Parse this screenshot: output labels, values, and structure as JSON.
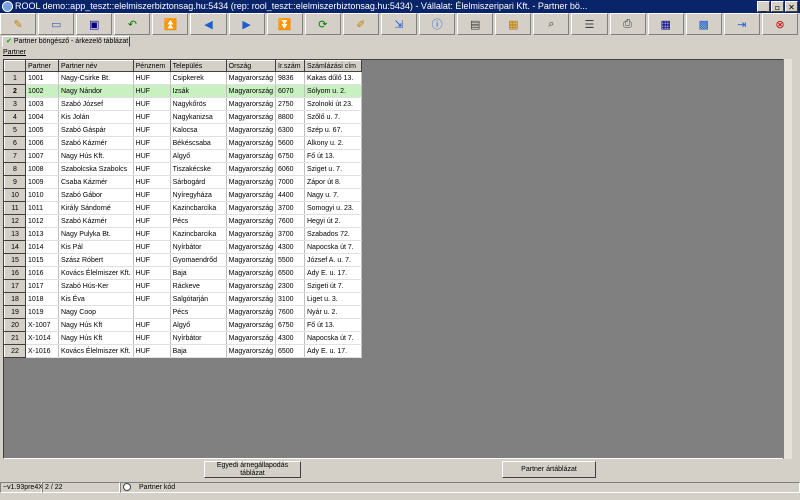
{
  "window": {
    "title": "ROOL demo::app_teszt::elelmiszerbiztonsag.hu:5434 (rep: rool_teszt::elelmiszerbiztonsag.hu:5434) - Vállalat: Élelmiszeripari Kft. - Partner bö...",
    "minimize": "_",
    "restore": "▫",
    "close": "✕"
  },
  "toolbar": [
    {
      "name": "edit-icon",
      "glyph": "✎",
      "color": "#c08000"
    },
    {
      "name": "open-folder-icon",
      "glyph": "▭",
      "color": "#4060c0"
    },
    {
      "name": "save-icon",
      "glyph": "▣",
      "color": "#000080"
    },
    {
      "name": "undo-icon",
      "glyph": "↶",
      "color": "#008000"
    },
    {
      "name": "first-record-icon",
      "glyph": "⏫",
      "color": "#1c5fd0"
    },
    {
      "name": "previous-record-icon",
      "glyph": "◀",
      "color": "#1c5fd0"
    },
    {
      "name": "next-record-icon",
      "glyph": "▶",
      "color": "#1c5fd0"
    },
    {
      "name": "last-record-icon",
      "glyph": "⏬",
      "color": "#1c5fd0"
    },
    {
      "name": "refresh-icon",
      "glyph": "⟳",
      "color": "#008000"
    },
    {
      "name": "edit-record-icon",
      "glyph": "✐",
      "color": "#c08000"
    },
    {
      "name": "export-icon",
      "glyph": "⇲",
      "color": "#1c5fd0"
    },
    {
      "name": "info-icon",
      "glyph": "ⓘ",
      "color": "#1c5fd0"
    },
    {
      "name": "form-view-icon",
      "glyph": "▤",
      "color": "#404040"
    },
    {
      "name": "report-icon",
      "glyph": "▦",
      "color": "#c08000"
    },
    {
      "name": "search-icon",
      "glyph": "⌕",
      "color": "#404040"
    },
    {
      "name": "list-view-icon",
      "glyph": "☰",
      "color": "#404040"
    },
    {
      "name": "print-icon",
      "glyph": "⎙",
      "color": "#404040"
    },
    {
      "name": "table-view-icon",
      "glyph": "▦",
      "color": "#000080"
    },
    {
      "name": "settings-grid-icon",
      "glyph": "▩",
      "color": "#1c5fd0"
    },
    {
      "name": "exit-door-icon",
      "glyph": "⇥",
      "color": "#1c5fd0"
    },
    {
      "name": "cancel-icon",
      "glyph": "⊗",
      "color": "#d00000"
    }
  ],
  "tab": {
    "label": "Partner böngésző - árkezelő táblázat",
    "icon": "✔"
  },
  "section_label": "Partner",
  "table": {
    "headers": [
      "Partner",
      "Partner név",
      "Pénznem",
      "Település",
      "Ország",
      "Ir.szám",
      "Számlázási cím"
    ],
    "rows": [
      {
        "num": "1",
        "cells": [
          "1001",
          "Nagy-Csirke Bt.",
          "HUF",
          "Csipkerek",
          "Magyarország",
          "9836",
          "Kakas dűlő 13."
        ]
      },
      {
        "num": "2",
        "cells": [
          "1002",
          "Nagy Nándor",
          "HUF",
          "Izsák",
          "Magyarország",
          "6070",
          "Sólyom u. 2."
        ],
        "selected": true
      },
      {
        "num": "3",
        "cells": [
          "1003",
          "Szabó József",
          "HUF",
          "Nagykőrös",
          "Magyarország",
          "2750",
          "Szolnoki út 23."
        ]
      },
      {
        "num": "4",
        "cells": [
          "1004",
          "Kis Jolán",
          "HUF",
          "Nagykanizsa",
          "Magyarország",
          "8800",
          "Szőlő u. 7."
        ]
      },
      {
        "num": "5",
        "cells": [
          "1005",
          "Szabó Gáspár",
          "HUF",
          "Kalocsa",
          "Magyarország",
          "6300",
          "Szép u. 67."
        ]
      },
      {
        "num": "6",
        "cells": [
          "1006",
          "Szabó Kázmér",
          "HUF",
          "Békéscsaba",
          "Magyarország",
          "5600",
          "Alkony u. 2."
        ]
      },
      {
        "num": "7",
        "cells": [
          "1007",
          "Nagy Hús Kft.",
          "HUF",
          "Algyő",
          "Magyarország",
          "6750",
          "Fő út 13."
        ]
      },
      {
        "num": "8",
        "cells": [
          "1008",
          "Szabolcska Szabolcs",
          "HUF",
          "Tiszakécske",
          "Magyarország",
          "6060",
          "Sziget u. 7."
        ]
      },
      {
        "num": "9",
        "cells": [
          "1009",
          "Csaba Kázmér",
          "HUF",
          "Sárbogárd",
          "Magyarország",
          "7000",
          "Zápor út 8."
        ]
      },
      {
        "num": "10",
        "cells": [
          "1010",
          "Szabó Gábor",
          "HUF",
          "Nyíregyháza",
          "Magyarország",
          "4400",
          "Nagy u. 7."
        ]
      },
      {
        "num": "11",
        "cells": [
          "1011",
          "Király Sándorné",
          "HUF",
          "Kazincbarcika",
          "Magyarország",
          "3700",
          "Somogyi u. 23."
        ]
      },
      {
        "num": "12",
        "cells": [
          "1012",
          "Szabó Kázmér",
          "HUF",
          "Pécs",
          "Magyarország",
          "7600",
          "Hegyi út 2."
        ]
      },
      {
        "num": "13",
        "cells": [
          "1013",
          "Nagy Pulyka Bt.",
          "HUF",
          "Kazincbarcika",
          "Magyarország",
          "3700",
          "Szabados 72."
        ]
      },
      {
        "num": "14",
        "cells": [
          "1014",
          "Kis Pál",
          "HUF",
          "Nyírbátor",
          "Magyarország",
          "4300",
          "Napocska út 7."
        ]
      },
      {
        "num": "15",
        "cells": [
          "1015",
          "Szász Róbert",
          "HUF",
          "Gyomaendrőd",
          "Magyarország",
          "5500",
          "József A. u. 7."
        ]
      },
      {
        "num": "16",
        "cells": [
          "1016",
          "Kovács Élelmiszer Kft.",
          "HUF",
          "Baja",
          "Magyarország",
          "6500",
          "Ady E. u. 17."
        ]
      },
      {
        "num": "17",
        "cells": [
          "1017",
          "Szabó Hús-Ker",
          "HUF",
          "Ráckeve",
          "Magyarország",
          "2300",
          "Szigeti út 7."
        ]
      },
      {
        "num": "18",
        "cells": [
          "1018",
          "Kis Éva",
          "HUF",
          "Salgótarján",
          "Magyarország",
          "3100",
          "Liget u. 3."
        ]
      },
      {
        "num": "19",
        "cells": [
          "1019",
          "Nagy Coop",
          "",
          "Pécs",
          "Magyarország",
          "7600",
          "Nyár u. 2."
        ]
      },
      {
        "num": "20",
        "cells": [
          "X-1007",
          "Nagy Hús Kft",
          "HUF",
          "Algyő",
          "Magyarország",
          "6750",
          "Fő út 13."
        ]
      },
      {
        "num": "21",
        "cells": [
          "X-1014",
          "Nagy Hús Kft",
          "HUF",
          "Nyírbátor",
          "Magyarország",
          "4300",
          "Napocska út 7."
        ]
      },
      {
        "num": "22",
        "cells": [
          "X-1016",
          "Kovács Élelmiszer Kft.",
          "HUF",
          "Baja",
          "Magyarország",
          "6500",
          "Ady E. u. 17."
        ]
      }
    ]
  },
  "buttons": {
    "unit_price": "Egyedi árnegállapodás táblázat",
    "price_table": "Partner ártáblázat"
  },
  "status": {
    "version": "~v1.93pre4X",
    "position": "2 / 22",
    "radio_label": "Partner kód"
  },
  "colors": {
    "selected_row": "#c8f0c0",
    "title_bar": "#0a246a"
  }
}
